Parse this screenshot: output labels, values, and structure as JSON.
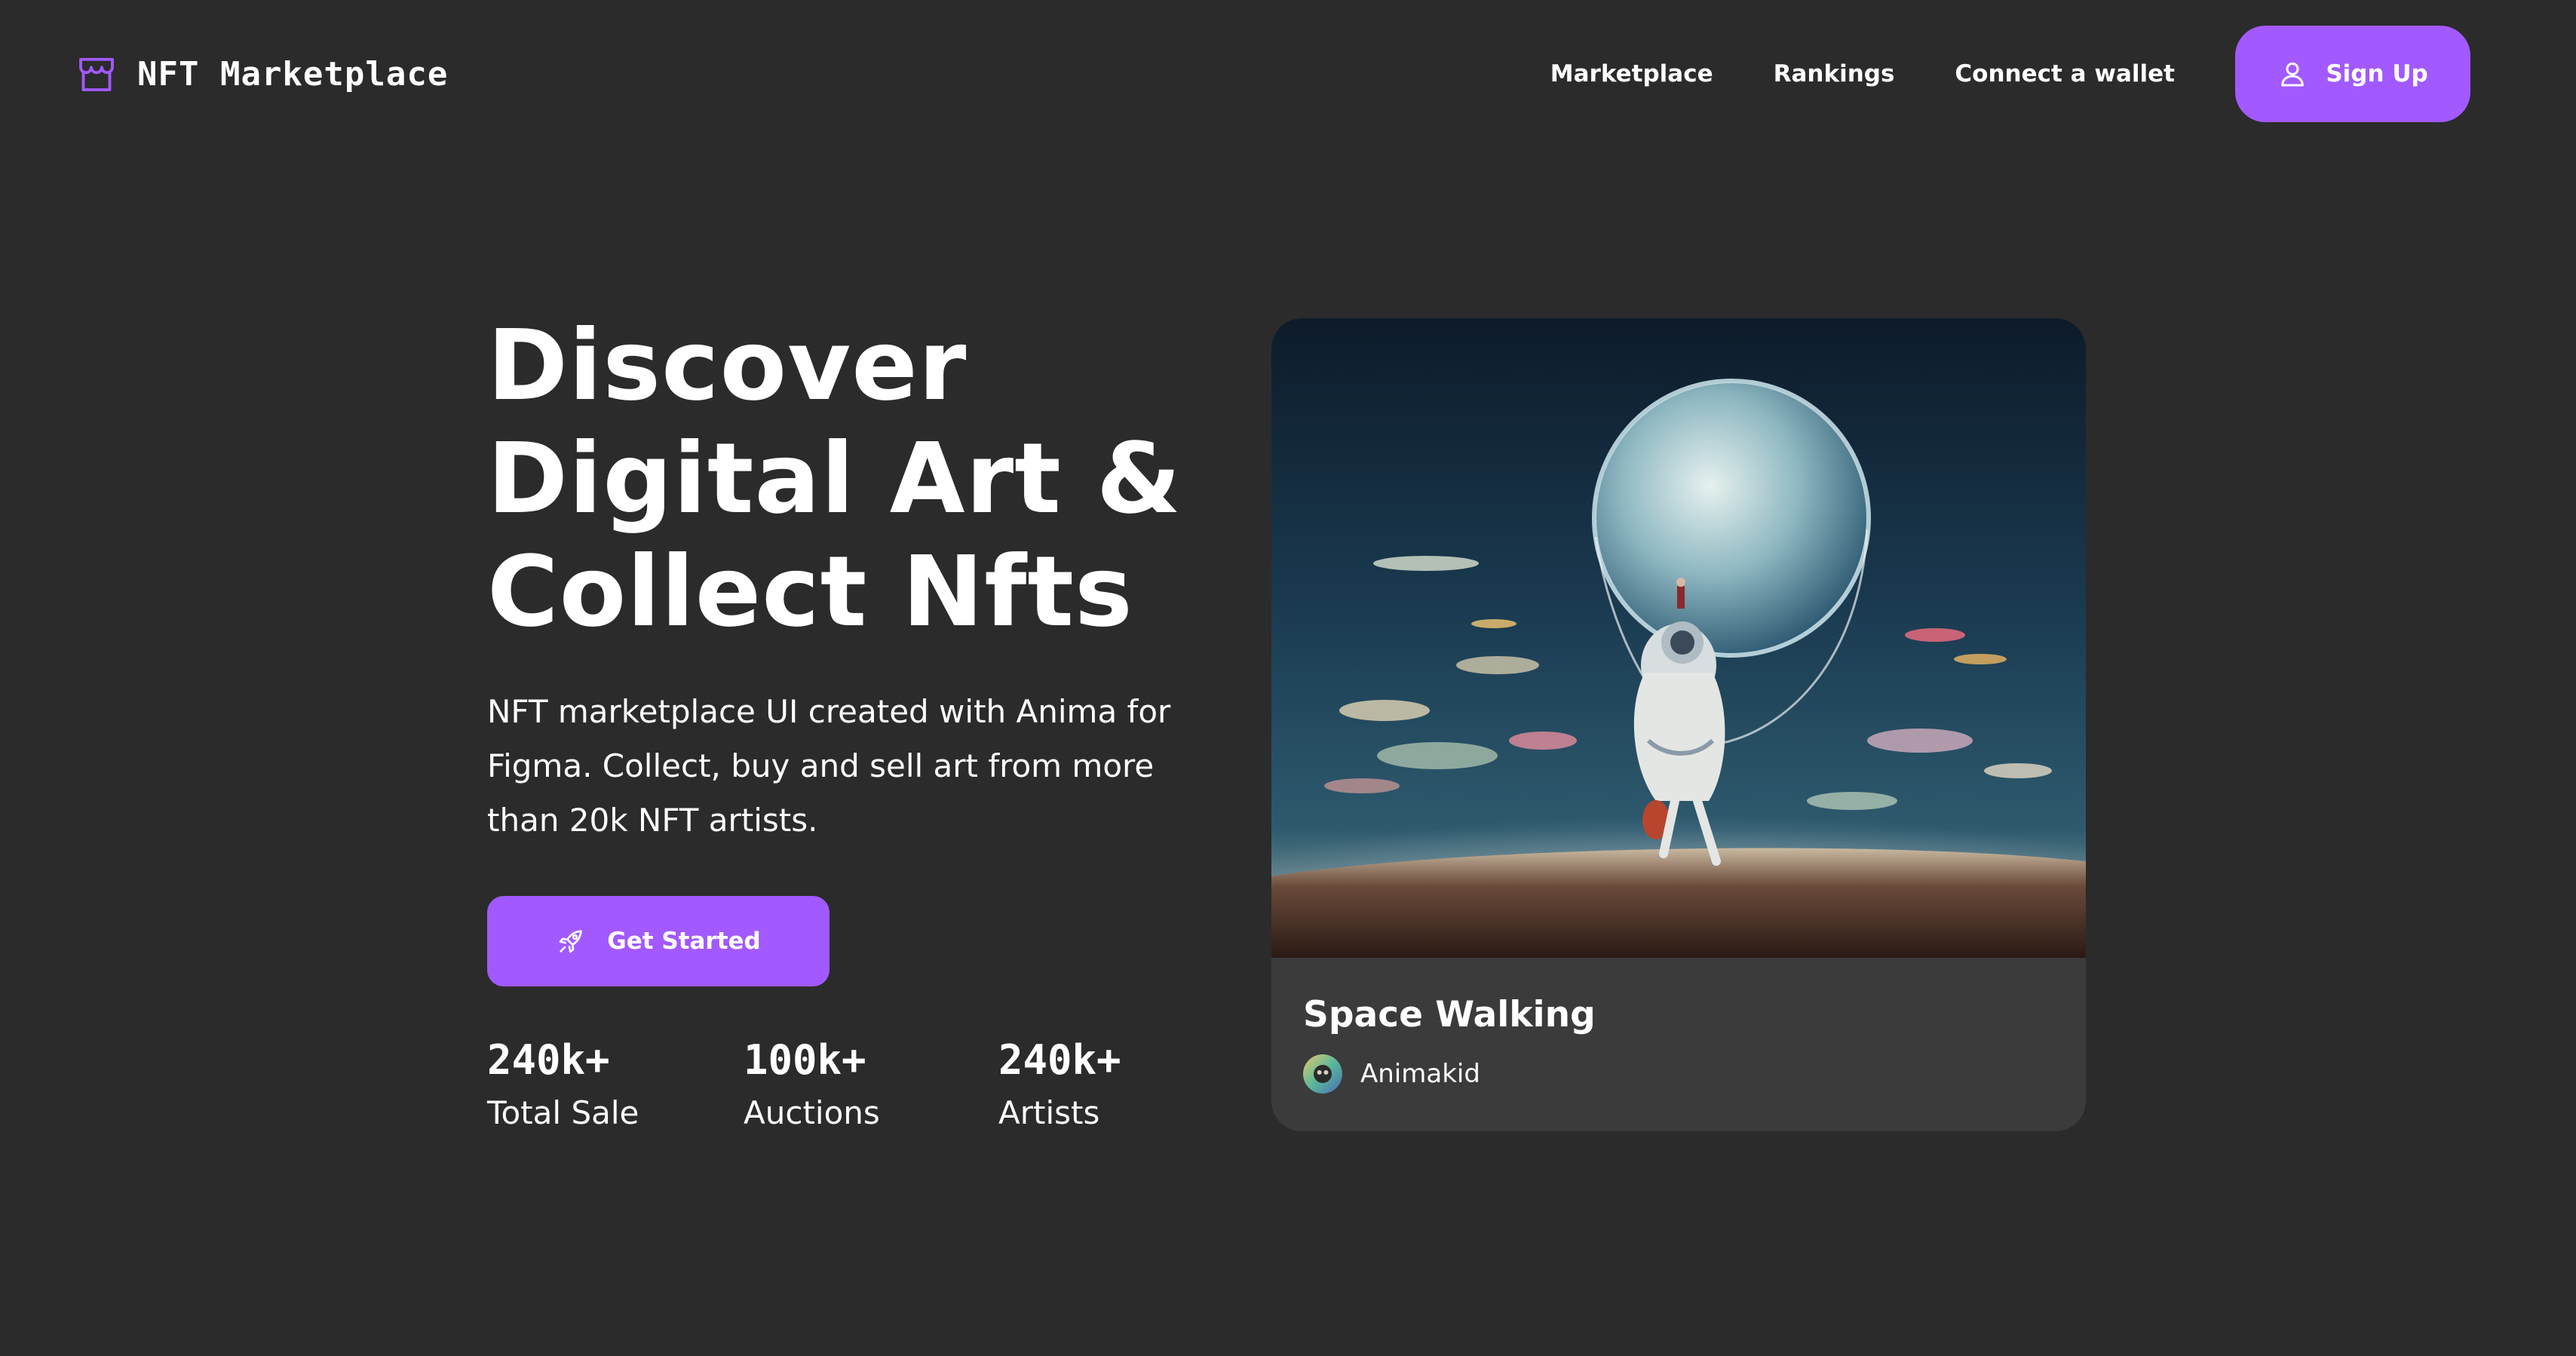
{
  "brand": {
    "logo_icon": "storefront-icon",
    "name": "NFT Marketplace",
    "accent_color": "#a259ff",
    "background_color": "#2b2b2b",
    "card_color": "#3b3b3b"
  },
  "nav": {
    "links": [
      "Marketplace",
      "Rankings",
      "Connect a wallet"
    ],
    "signup": {
      "icon": "user-icon",
      "label": "Sign Up"
    }
  },
  "hero": {
    "title_lines": [
      "Discover",
      "Digital Art &",
      "Collect Nfts"
    ],
    "description": "NFT marketplace UI created with Anima for Figma. Collect, buy and sell art from more than 20k NFT artists.",
    "cta": {
      "icon": "rocket-icon",
      "label": "Get Started"
    },
    "stats": [
      {
        "value": "240k+",
        "label": "Total Sale"
      },
      {
        "value": "100k+",
        "label": "Auctions"
      },
      {
        "value": "240k+",
        "label": "Artists"
      }
    ]
  },
  "featured": {
    "title": "Space Walking",
    "artist": "Animakid",
    "avatar_icon": "artist-avatar"
  }
}
